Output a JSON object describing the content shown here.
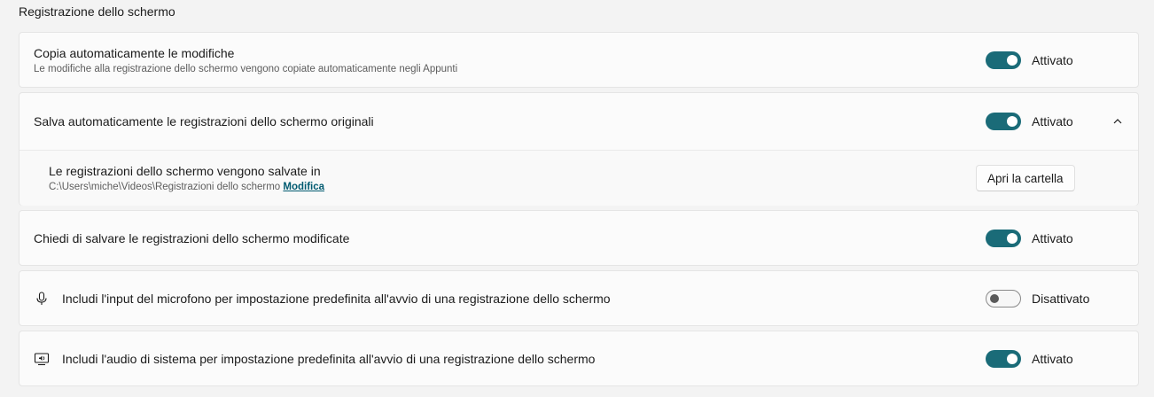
{
  "section": {
    "title": "Registrazione dello schermo"
  },
  "settings": {
    "auto_copy": {
      "title": "Copia automaticamente le modifiche",
      "subtitle": "Le modifiche alla registrazione dello schermo vengono copiate automaticamente negli Appunti",
      "state": "Attivato",
      "on": true
    },
    "auto_save": {
      "title": "Salva automaticamente le registrazioni dello schermo originali",
      "state": "Attivato",
      "on": true,
      "expanded": true,
      "chevron_icon": "chevron-up-icon",
      "save_location": {
        "title": "Le registrazioni dello schermo vengono salvate in",
        "path": "C:\\Users\\miche\\Videos\\Registrazioni dello schermo",
        "edit_link": "Modifica",
        "open_folder_button": "Apri la cartella"
      }
    },
    "ask_save": {
      "title": "Chiedi di salvare le registrazioni dello schermo modificate",
      "state": "Attivato",
      "on": true
    },
    "microphone": {
      "icon": "microphone-icon",
      "title": "Includi l'input del microfono per impostazione predefinita all'avvio di una registrazione dello schermo",
      "state": "Disattivato",
      "on": false
    },
    "system_audio": {
      "icon": "system-audio-icon",
      "title": "Includi l'audio di sistema per impostazione predefinita all'avvio di una registrazione dello schermo",
      "state": "Attivato",
      "on": true
    }
  },
  "colors": {
    "accent": "#1a6b78",
    "link": "#005a70",
    "background": "#f3f3f3",
    "card": "#fbfbfb"
  }
}
